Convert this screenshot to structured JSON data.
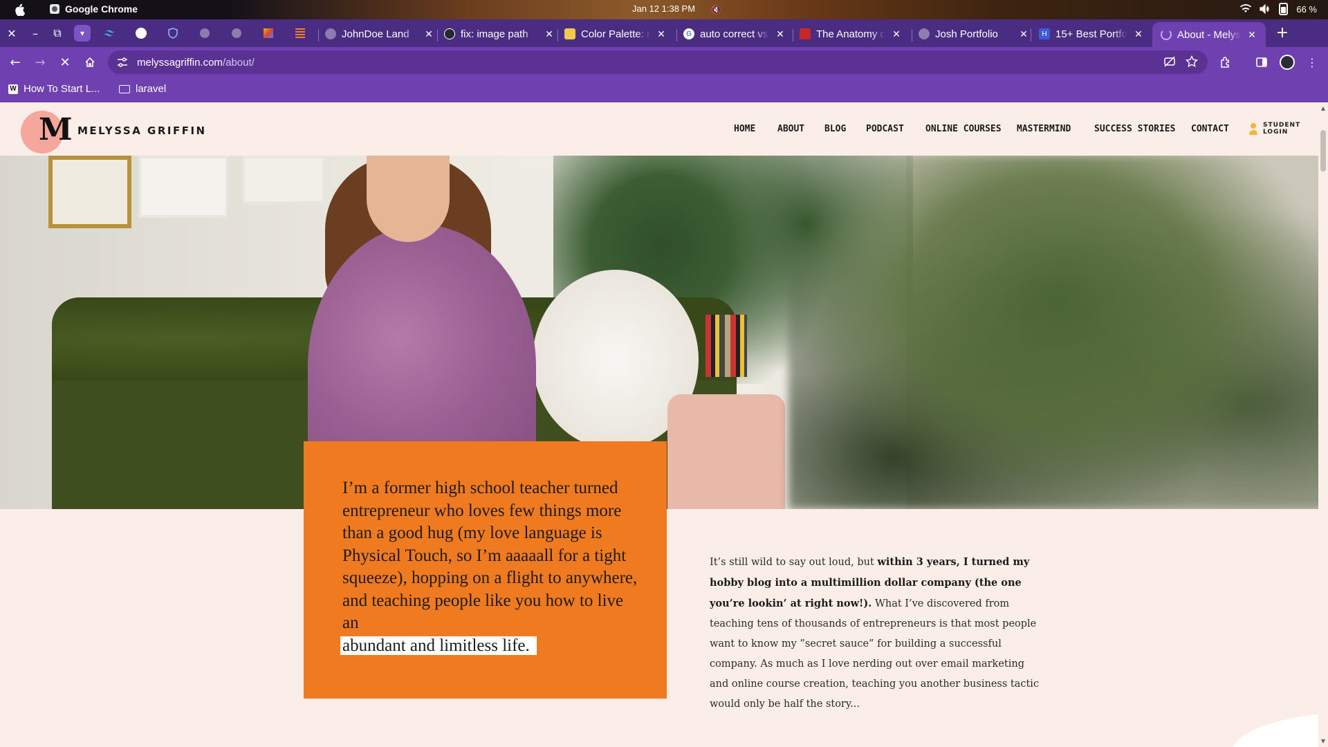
{
  "os_bar": {
    "app_name": "Google Chrome",
    "clock": "Jan 12  1:38 PM",
    "battery": "66 %"
  },
  "tabs": [
    {
      "title": "JohnDoe Land"
    },
    {
      "title": "fix: image path"
    },
    {
      "title": "Color Palette: r"
    },
    {
      "title": "auto correct vs"
    },
    {
      "title": "The Anatomy o"
    },
    {
      "title": "Josh Portfolio"
    },
    {
      "title": "15+ Best Portfo"
    },
    {
      "title": "About - Melyss"
    }
  ],
  "address_bar": {
    "host": "melyssagriffin.com",
    "path": "/about/"
  },
  "bookmarks": [
    {
      "label": "How To Start L..."
    },
    {
      "label": "laravel"
    }
  ],
  "site": {
    "logo_letter": "M",
    "logo_text": "MELYSSA GRIFFIN",
    "nav": [
      "HOME",
      "ABOUT",
      "BLOG",
      "PODCAST",
      "ONLINE COURSES",
      "MASTERMIND",
      "SUCCESS STORIES",
      "CONTACT"
    ],
    "student_login_line1": "STUDENT",
    "student_login_line2": "LOGIN"
  },
  "quote": {
    "text": "I’m a former high school teacher turned entrepreneur who loves few things more than a good hug (my love language is Physical Touch, so I’m aaaaall for a tight squeeze), hopping on a flight to anywhere, and teaching people like you how to live an",
    "highlight": "abundant and limitless life."
  },
  "body": {
    "intro": "It’s still wild to say out loud, but ",
    "bold": "within 3 years, I turned my hobby blog into a multimillion dollar company (the one you’re lookin’ at right now!).",
    "rest": " What I’ve discovered from teaching tens of thousands of entrepreneurs is that most people want to know my ”secret sauce” for building a successful company. As much as I love nerding out over email marketing and online course creation, teaching you another business tactic would only be half the story..."
  },
  "colors": {
    "browser_purple": "#6f40b0",
    "tab_strip": "#4a2c82",
    "page_bg": "#fbeee8",
    "orange": "#f07a20",
    "logo_pink": "#f6a79c"
  }
}
